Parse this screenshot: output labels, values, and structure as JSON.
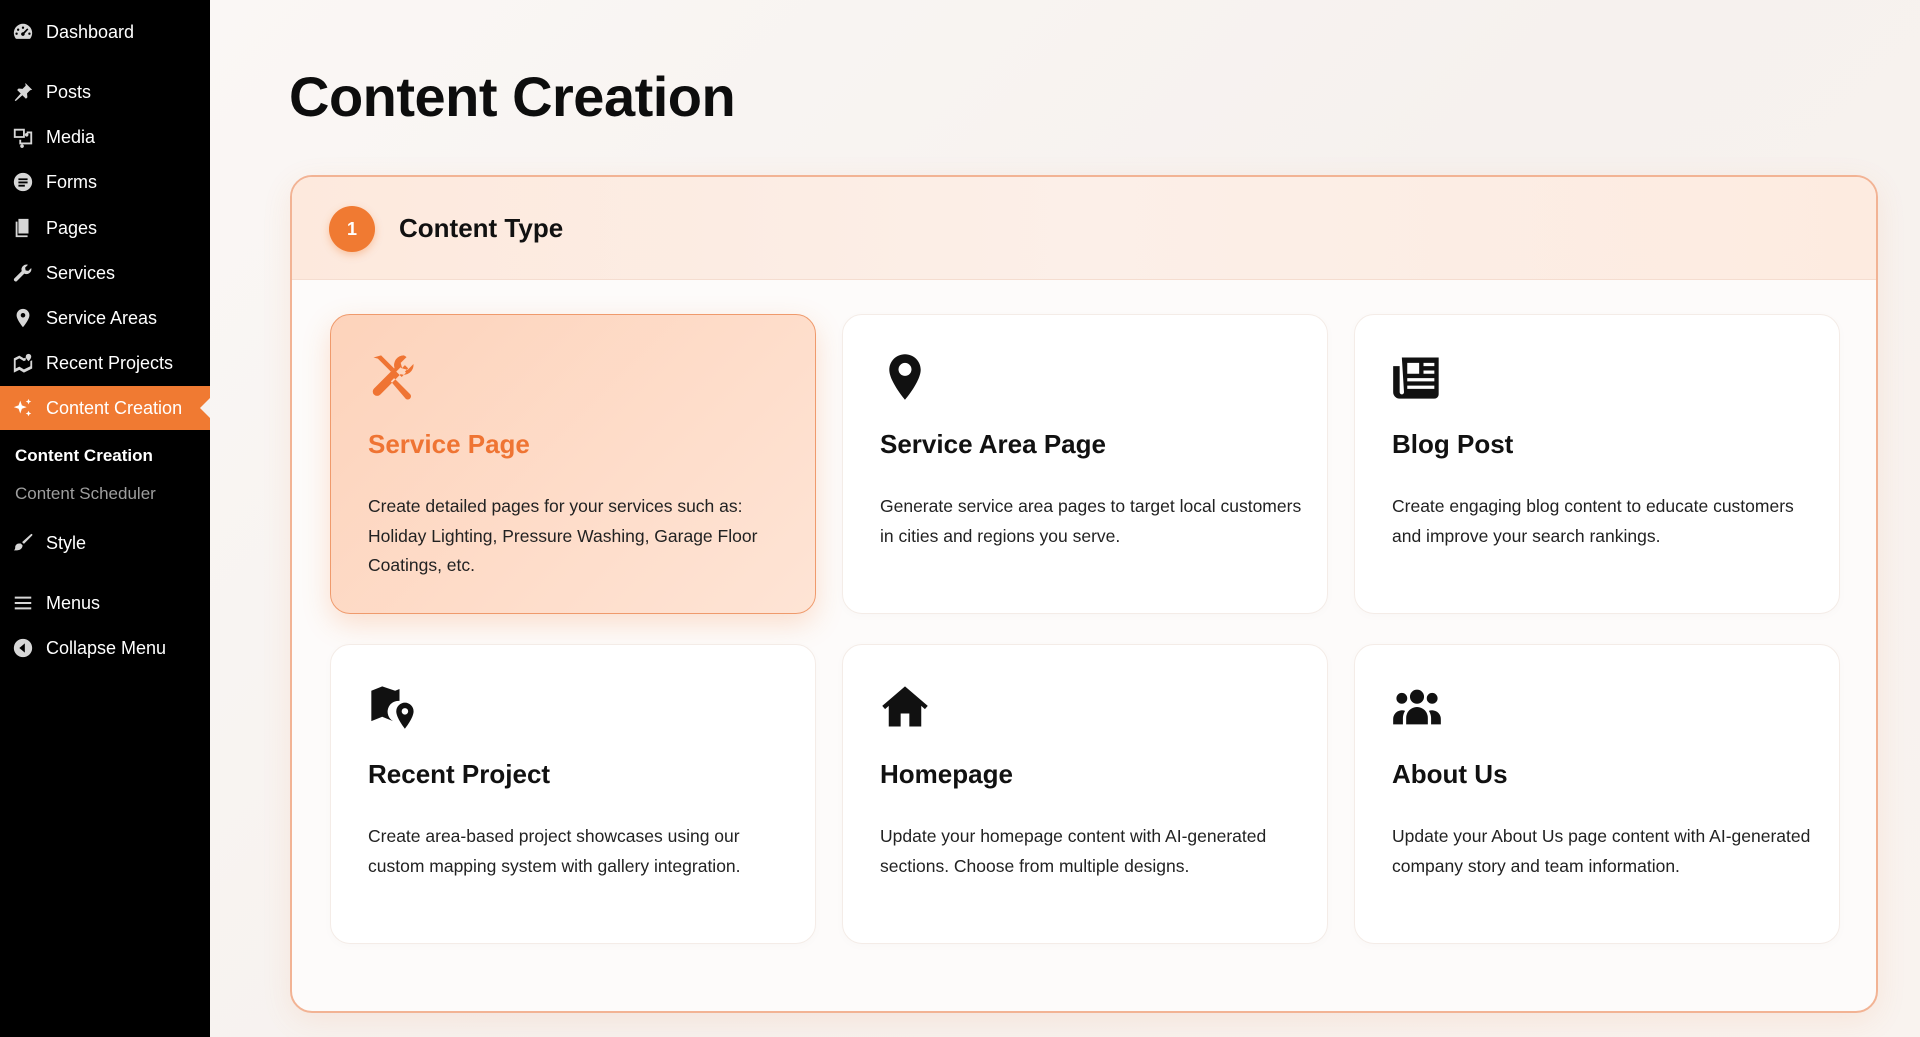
{
  "sidebar": {
    "items": [
      {
        "label": "Dashboard",
        "icon": "dashboard-icon"
      },
      {
        "label": "Posts",
        "icon": "pin-icon"
      },
      {
        "label": "Media",
        "icon": "media-icon"
      },
      {
        "label": "Forms",
        "icon": "forms-icon"
      },
      {
        "label": "Pages",
        "icon": "pages-icon"
      },
      {
        "label": "Services",
        "icon": "wrench-icon"
      },
      {
        "label": "Service Areas",
        "icon": "location-pin-icon"
      },
      {
        "label": "Recent Projects",
        "icon": "projects-icon"
      },
      {
        "label": "Content Creation",
        "icon": "sparkle-icon"
      },
      {
        "label": "Style",
        "icon": "brush-icon"
      },
      {
        "label": "Menus",
        "icon": "menu-icon"
      },
      {
        "label": "Collapse Menu",
        "icon": "collapse-icon"
      }
    ],
    "submenu": [
      {
        "label": "Content Creation"
      },
      {
        "label": "Content Scheduler"
      }
    ]
  },
  "main": {
    "title": "Content Creation",
    "step": {
      "number": "1",
      "title": "Content Type"
    },
    "cards": [
      {
        "title": "Service Page",
        "icon": "tools-icon",
        "selected": true,
        "description": "Create detailed pages for your services such as: Holiday Lighting, Pressure Washing, Garage Floor Coatings, etc."
      },
      {
        "title": "Service Area Page",
        "icon": "map-marker-icon",
        "selected": false,
        "description": "Generate service area pages to target local customers in cities and regions you serve."
      },
      {
        "title": "Blog Post",
        "icon": "newspaper-icon",
        "selected": false,
        "description": "Create engaging blog content to educate customers and improve your search rankings."
      },
      {
        "title": "Recent Project",
        "icon": "map-location-icon",
        "selected": false,
        "description": "Create area-based project showcases using our custom mapping system with gallery integration."
      },
      {
        "title": "Homepage",
        "icon": "home-icon",
        "selected": false,
        "description": "Update your homepage content with AI-generated sections. Choose from multiple designs."
      },
      {
        "title": "About Us",
        "icon": "users-icon",
        "selected": false,
        "description": "Update your About Us page content with AI-generated company story and team information."
      }
    ]
  },
  "colors": {
    "accent": "#f07a32",
    "sidebar_bg": "#000000"
  }
}
